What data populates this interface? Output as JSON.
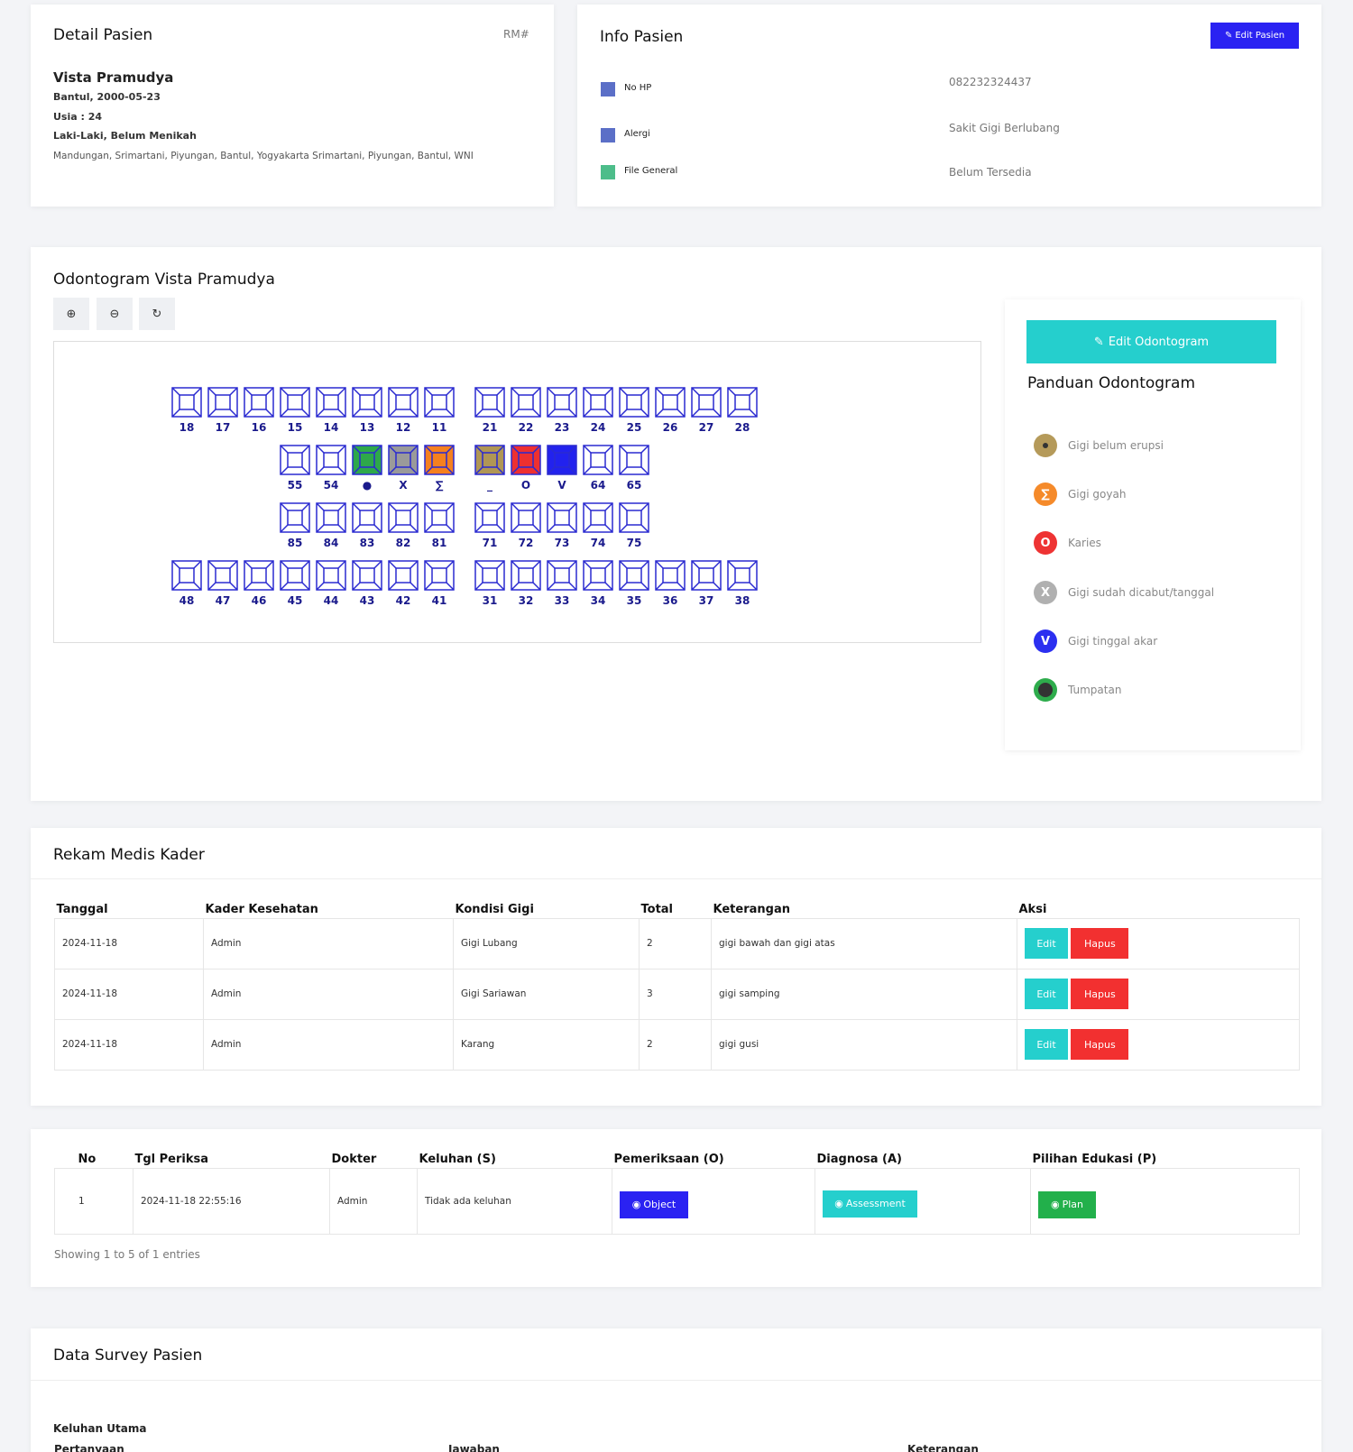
{
  "detail": {
    "title": "Detail Pasien",
    "rm": "RM#",
    "name": "Vista Pramudya",
    "birth": "Bantul, 2000-05-23",
    "age": "Usia : 24",
    "status": "Laki-Laki, Belum Menikah",
    "address": "Mandungan, Srimartani, Piyungan, Bantul, Yogyakarta Srimartani, Piyungan, Bantul, WNI"
  },
  "info": {
    "title": "Info Pasien",
    "edit_button": "Edit Pasien",
    "rows": [
      {
        "label": "No HP",
        "value": "082232324437",
        "color": "#5b6fc7"
      },
      {
        "label": "Alergi",
        "value": "Sakit Gigi Berlubang",
        "color": "#5b6fc7"
      },
      {
        "label": "File General",
        "value": "Belum Tersedia",
        "color": "#4dbd8a"
      }
    ]
  },
  "odontogram": {
    "title": "Odontogram Vista Pramudya",
    "edit_button": "Edit Odontogram",
    "guide_title": "Panduan Odontogram",
    "row1": [
      "18",
      "17",
      "16",
      "15",
      "14",
      "13",
      "12",
      "11",
      "21",
      "22",
      "23",
      "24",
      "25",
      "26",
      "27",
      "28"
    ],
    "row2": [
      "55",
      "54",
      "●",
      "X",
      "∑",
      "_",
      "O",
      "V",
      "64",
      "65"
    ],
    "row3": [
      "85",
      "84",
      "83",
      "82",
      "81",
      "71",
      "72",
      "73",
      "74",
      "75"
    ],
    "row4": [
      "48",
      "47",
      "46",
      "45",
      "44",
      "43",
      "42",
      "41",
      "31",
      "32",
      "33",
      "34",
      "35",
      "36",
      "37",
      "38"
    ],
    "row2_fill": [
      "",
      "",
      "#2ea84a",
      "#9a9a9a",
      "#f5801f",
      "#b09655",
      "#ee3030",
      "#2222ee",
      "",
      ""
    ],
    "legend": [
      {
        "symbol": "●",
        "label": "Gigi belum erupsi",
        "color": "#b59a5a"
      },
      {
        "symbol": "∑",
        "label": "Gigi goyah",
        "color": "#f58a2a"
      },
      {
        "symbol": "O",
        "label": "Karies",
        "color": "#ee3333"
      },
      {
        "symbol": "X",
        "label": "Gigi sudah dicabut/tanggal",
        "color": "#b0b0b0"
      },
      {
        "symbol": "V",
        "label": "Gigi tinggal akar",
        "color": "#2b2ff0"
      },
      {
        "symbol": "",
        "label": "Tumpatan",
        "color": "#2eac4c"
      }
    ]
  },
  "rekam": {
    "title": "Rekam Medis Kader",
    "headers": [
      "Tanggal",
      "Kader Kesehatan",
      "Kondisi Gigi",
      "Total",
      "Keterangan",
      "Aksi"
    ],
    "rows": [
      [
        "2024-11-18",
        "Admin",
        "Gigi Lubang",
        "2",
        "gigi bawah dan gigi atas"
      ],
      [
        "2024-11-18",
        "Admin",
        "Gigi Sariawan",
        "3",
        "gigi samping"
      ],
      [
        "2024-11-18",
        "Admin",
        "Karang",
        "2",
        "gigi gusi"
      ]
    ],
    "edit_label": "Edit",
    "delete_label": "Hapus"
  },
  "soap": {
    "headers": [
      "No",
      "Tgl Periksa",
      "Dokter",
      "Keluhan (S)",
      "Pemeriksaan (O)",
      "Diagnosa (A)",
      "Pilihan Edukasi (P)"
    ],
    "row": [
      "1",
      "2024-11-18 22:55:16",
      "Admin",
      "Tidak ada keluhan"
    ],
    "object_label": "Object",
    "assessment_label": "Assessment",
    "plan_label": "Plan",
    "footer": "Showing 1 to 5 of 1 entries"
  },
  "survey": {
    "title": "Data Survey Pasien",
    "section": "Keluhan Utama",
    "headers": [
      "Pertanyaan",
      "Jawaban",
      "Keterangan"
    ]
  }
}
